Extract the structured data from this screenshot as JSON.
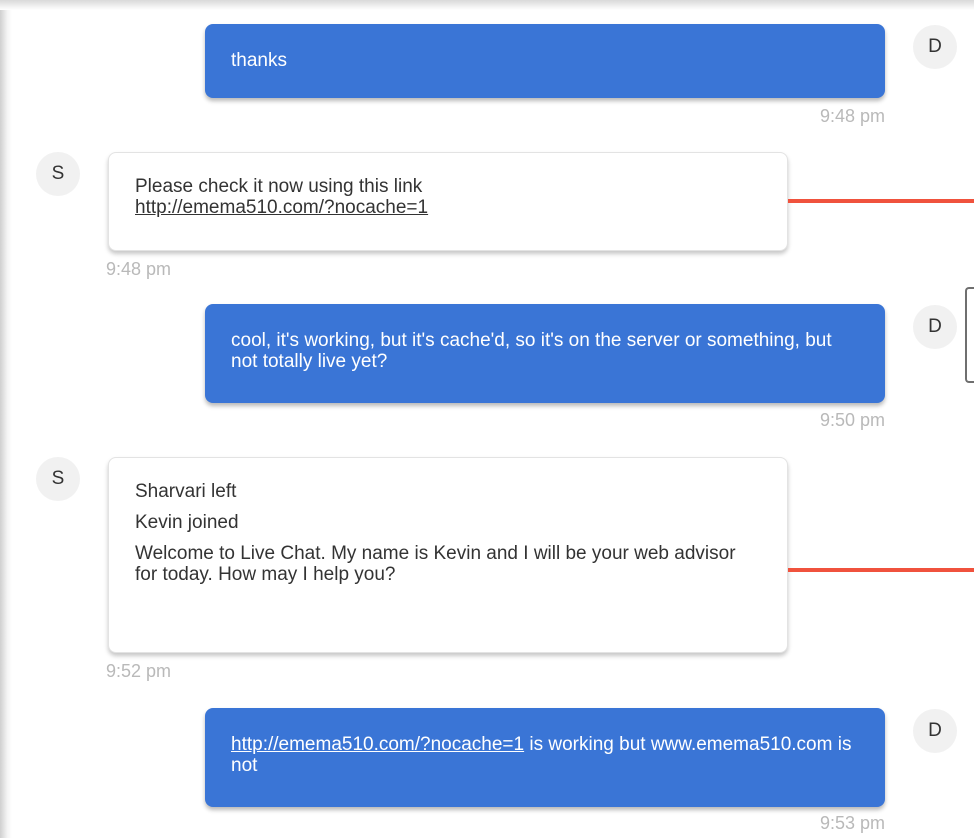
{
  "messages": [
    {
      "sender": "D",
      "direction": "outgoing",
      "lines": [
        "thanks"
      ],
      "time": "9:48 pm"
    },
    {
      "sender": "S",
      "direction": "incoming",
      "line1": "Please  check it now using this link",
      "link": "http://emema510.com/?nocache=1",
      "time": "9:48 pm"
    },
    {
      "sender": "D",
      "direction": "outgoing",
      "text": "cool, it's working, but it's cache'd, so it's on the server or something, but not totally live yet?",
      "time": "9:50 pm"
    },
    {
      "sender": "S",
      "direction": "incoming",
      "lines": [
        "Sharvari left",
        "Kevin joined",
        "Welcome to Live Chat. My name is Kevin and I will be your web advisor for today. How may I help you?"
      ],
      "time": "9:52 pm"
    },
    {
      "sender": "D",
      "direction": "outgoing",
      "link": "http://emema510.com/?nocache=1",
      "text_after_link": " is working but www.emema510.com is not",
      "time": "9:53 pm"
    }
  ],
  "colors": {
    "outgoing_bubble": "#3a75d6",
    "incoming_bubble": "#ffffff",
    "timestamp": "#b9b9b9",
    "annotation_line": "#f0523d"
  }
}
